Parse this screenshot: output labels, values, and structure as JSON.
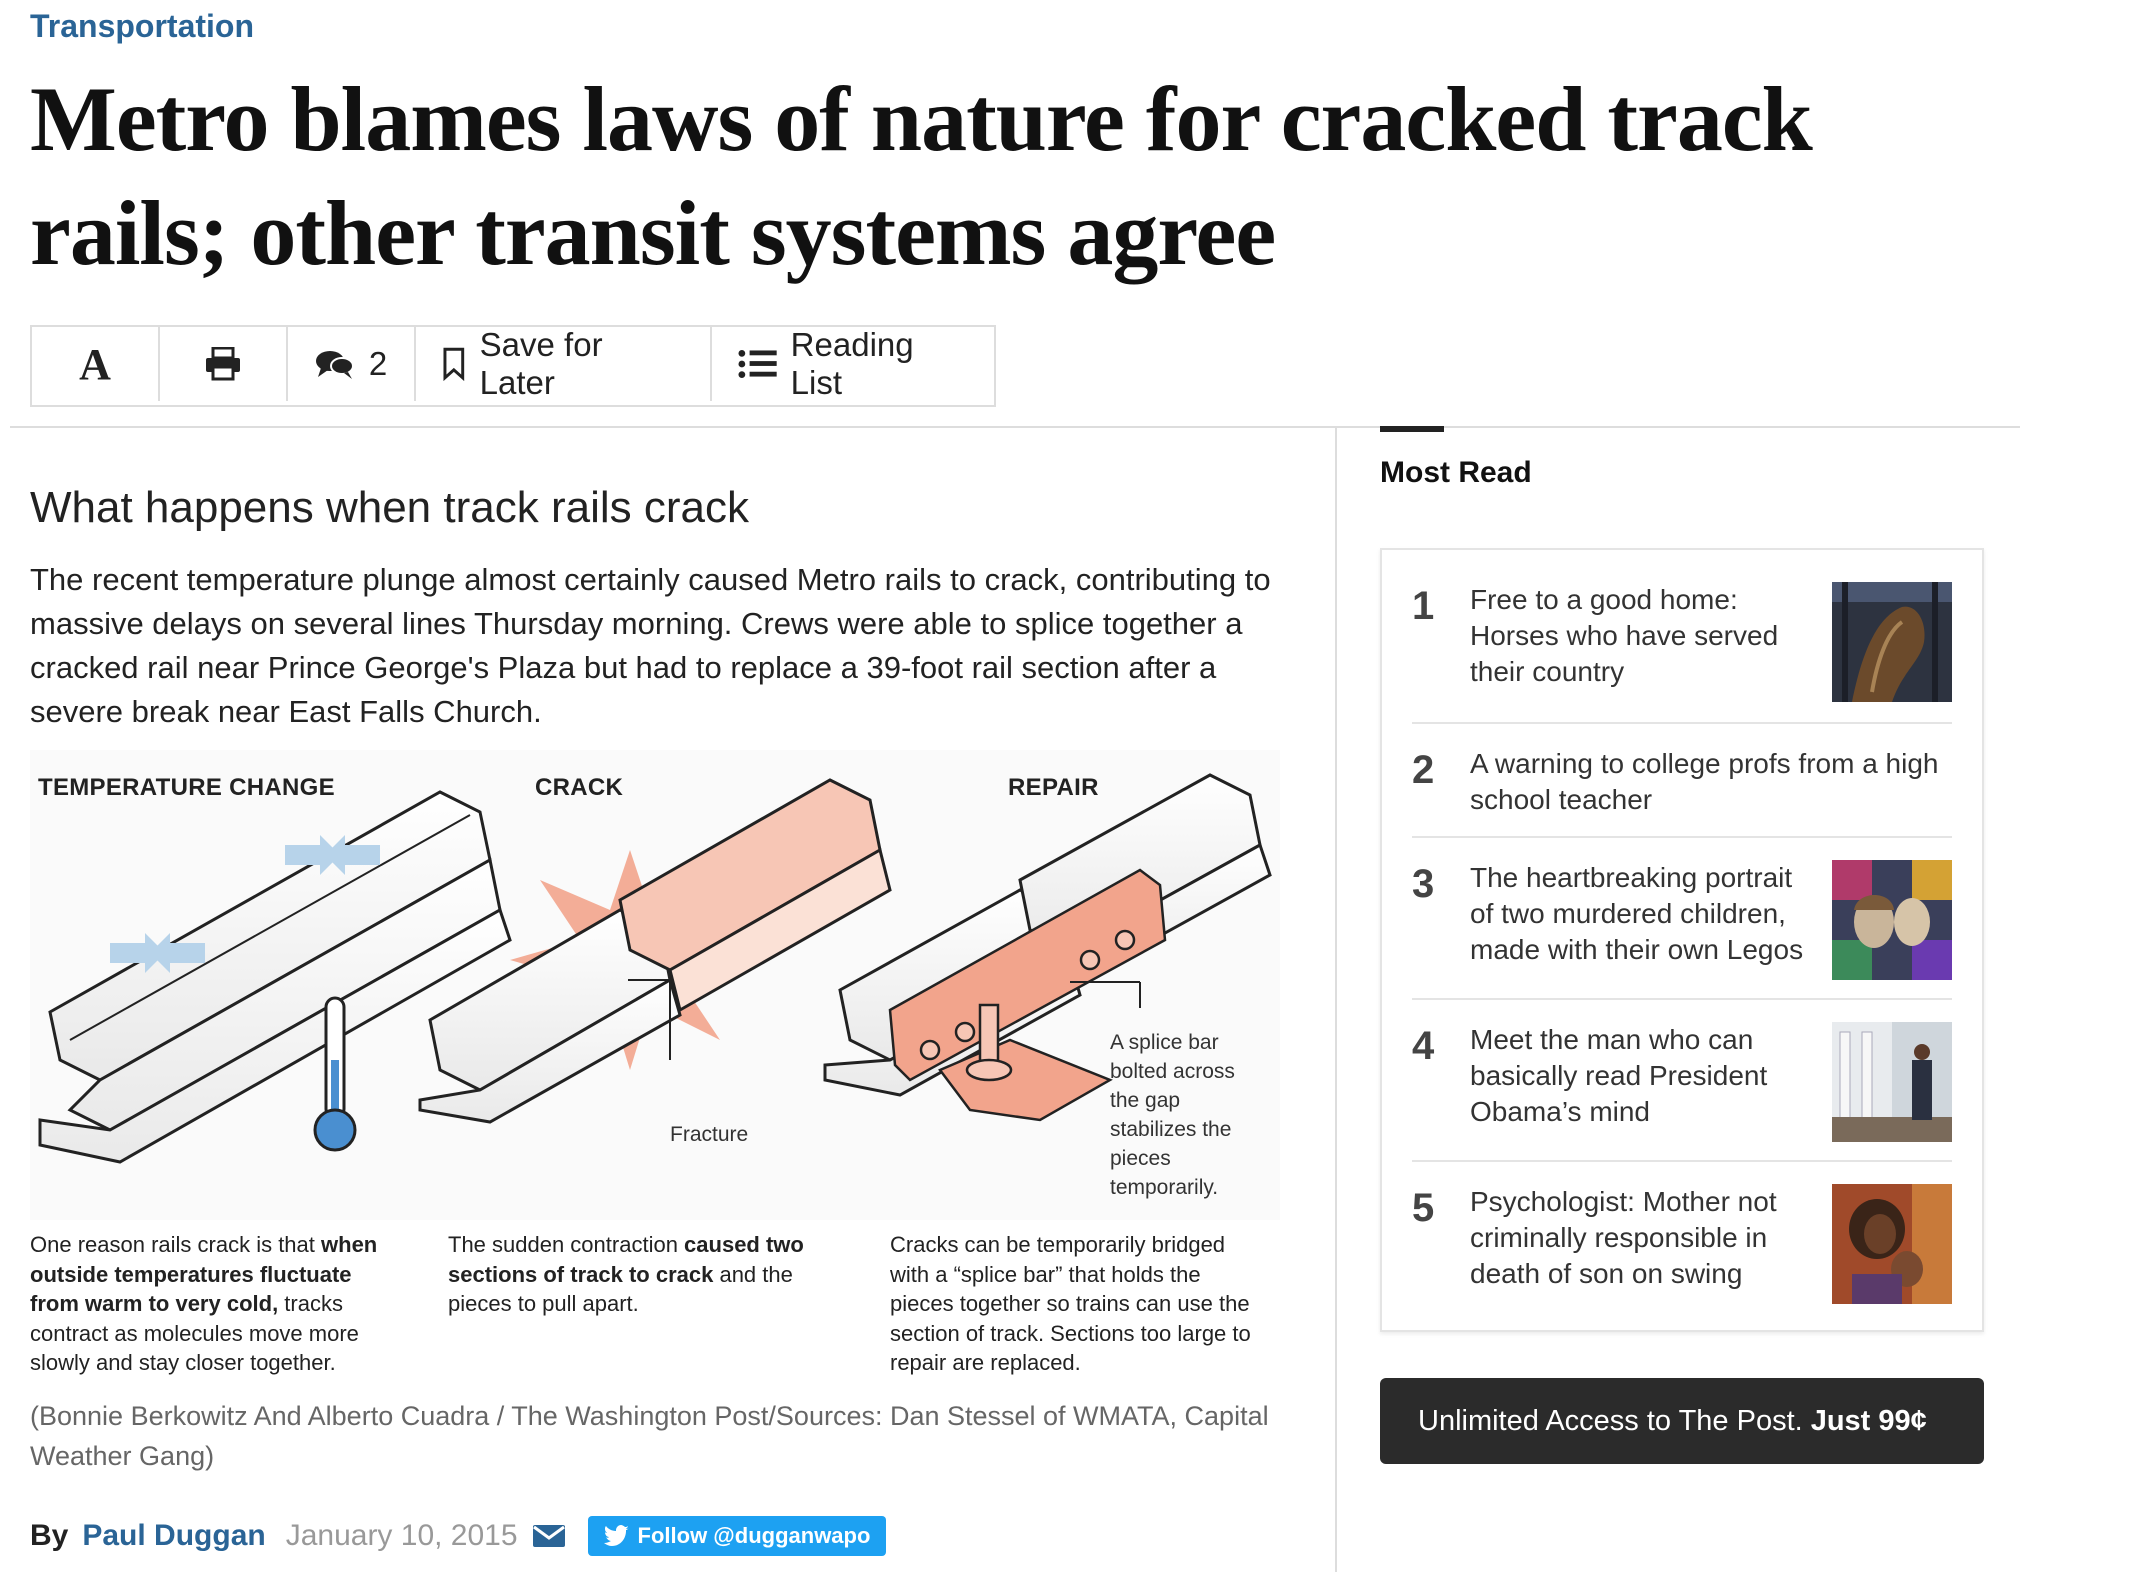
{
  "kicker": "Transportation",
  "headline": "Metro blames laws of nature for cracked track rails; other transit systems agree",
  "toolbar": {
    "font_label": "A",
    "comments_count": "2",
    "save_label": "Save for Later",
    "reading_list_label": "Reading List"
  },
  "article": {
    "subhead": "What happens when track rails crack",
    "lede": "The recent temperature plunge almost certainly caused Metro rails to crack, contributing to massive delays on several lines Thursday morning. Crews were able to splice together a cracked rail near Prince George's Plaza but had to replace a 39-foot rail section after a severe break near East Falls Church."
  },
  "graphic": {
    "panel1_title": "TEMPERATURE CHANGE",
    "panel2_title": "CRACK",
    "panel3_title": "REPAIR",
    "fracture_label": "Fracture",
    "splice_note": [
      "A splice bar",
      "bolted across",
      "the gap",
      "stabilizes the",
      "pieces",
      "temporarily."
    ],
    "caption1": {
      "a": "One reason rails crack is that ",
      "b": "when outside temperatures fluctuate from warm to very cold,",
      "c": " tracks contract as molecules move more slowly and stay closer together."
    },
    "caption2": {
      "a": "The sudden contraction ",
      "b": "caused two sections of track to crack",
      "c": " and the pieces to pull apart."
    },
    "caption3": "Cracks can be temporarily bridged with a “splice bar” that holds the pieces together so trains can use the section of track. Sections too large to repair are replaced.",
    "credit": "(Bonnie Berkowitz And Alberto Cuadra / The Washington Post/Sources: Dan Stessel of WMATA, Capital Weather Gang)"
  },
  "byline": {
    "by": "By",
    "author": "Paul Duggan",
    "date": "January 10, 2015",
    "follow_label": "Follow @dugganwapo"
  },
  "most_read": {
    "title": "Most Read",
    "items": [
      {
        "num": "1",
        "text": "Free to a good home: Horses who have served their country"
      },
      {
        "num": "2",
        "text": "A warning to college profs from a high school teacher"
      },
      {
        "num": "3",
        "text": "The heartbreaking portrait of two murdered children, made with their own Legos"
      },
      {
        "num": "4",
        "text": "Meet the man who can basically read President Obama’s mind"
      },
      {
        "num": "5",
        "text": "Psychologist: Mother not criminally responsible in death of son on swing"
      }
    ]
  },
  "promo": {
    "text": "Unlimited Access to The Post. ",
    "price": "Just 99¢"
  },
  "colors": {
    "link": "#2a6496",
    "twitter": "#1da1f2",
    "rail_accent": "#f2a48c",
    "cold_arrows": "#b7d3ea"
  }
}
